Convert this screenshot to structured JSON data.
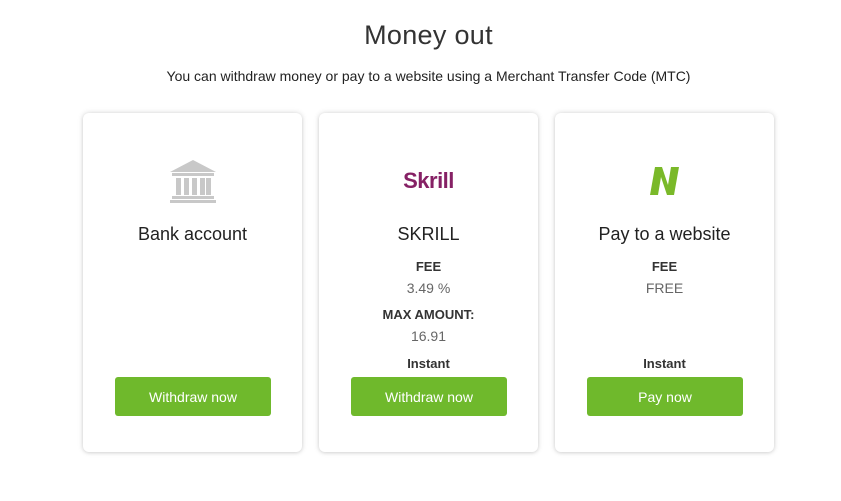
{
  "header": {
    "title": "Money out",
    "subtitle": "You can withdraw money or pay to a website using a Merchant Transfer Code (MTC)"
  },
  "colors": {
    "button": "#6fb92c",
    "skrill": "#862165",
    "neteller_n": "#7ab929",
    "bank_icon": "#c8c8c8"
  },
  "cards": [
    {
      "icon": "bank-icon",
      "name": "Bank account",
      "button_label": "Withdraw now"
    },
    {
      "icon": "skrill-logo",
      "logo_text": "Skrill",
      "name": "SKRILL",
      "fee_label": "FEE",
      "fee_value": "3.49 %",
      "max_label": "MAX AMOUNT:",
      "max_value": "16.91",
      "speed": "Instant",
      "button_label": "Withdraw now"
    },
    {
      "icon": "neteller-n-icon",
      "name": "Pay to a website",
      "fee_label": "FEE",
      "fee_value": "FREE",
      "speed": "Instant",
      "button_label": "Pay now"
    }
  ]
}
